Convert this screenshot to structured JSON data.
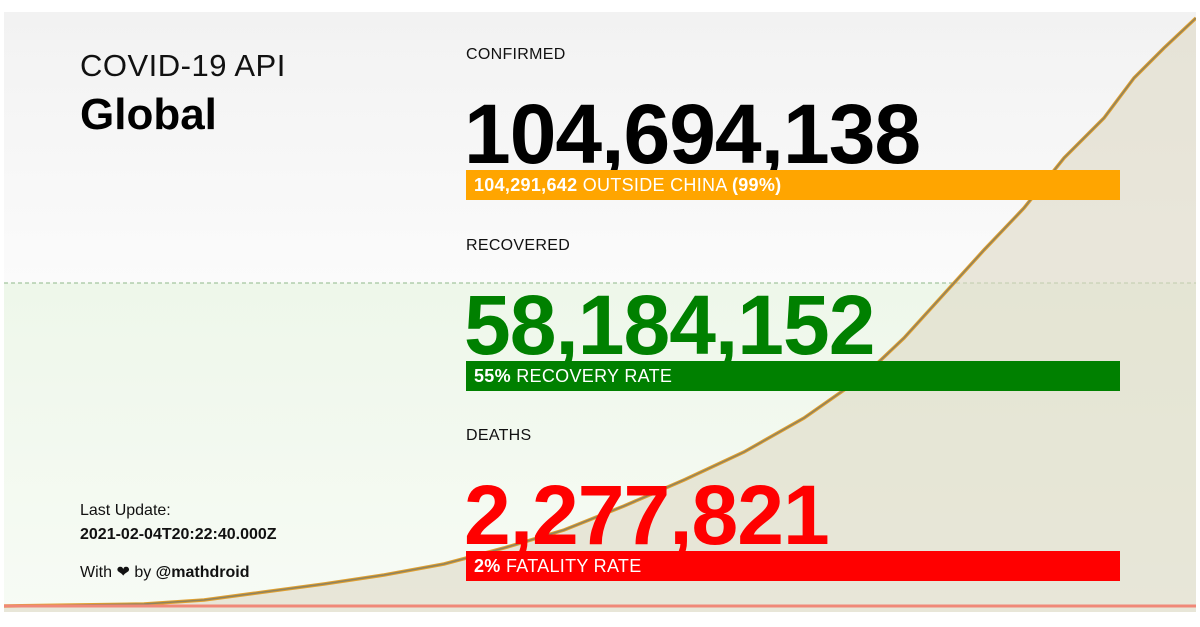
{
  "header": {
    "api_title": "COVID-19 API",
    "region": "Global"
  },
  "confirmed": {
    "label": "CONFIRMED",
    "value": "104,694,138",
    "outside_value": "104,291,642",
    "outside_text": "OUTSIDE CHINA",
    "outside_pct": "(99%)",
    "color": "#ffa500"
  },
  "recovered": {
    "label": "RECOVERED",
    "value": "58,184,152",
    "rate": "55%",
    "rate_text": "RECOVERY RATE",
    "color": "#008000"
  },
  "deaths": {
    "label": "DEATHS",
    "value": "2,277,821",
    "rate": "2%",
    "rate_text": "FATALITY RATE",
    "color": "#ff0000"
  },
  "footer": {
    "last_update_label": "Last Update:",
    "last_update_value": "2021-02-04T20:22:40.000Z",
    "with_text": "With",
    "heart": "❤",
    "by_text": "by",
    "handle": "@mathdroid"
  },
  "background_chart": {
    "series": [
      "confirmed",
      "recovered",
      "deaths"
    ],
    "line_color": "#e0a030",
    "deaths_line_color": "#f08878"
  }
}
